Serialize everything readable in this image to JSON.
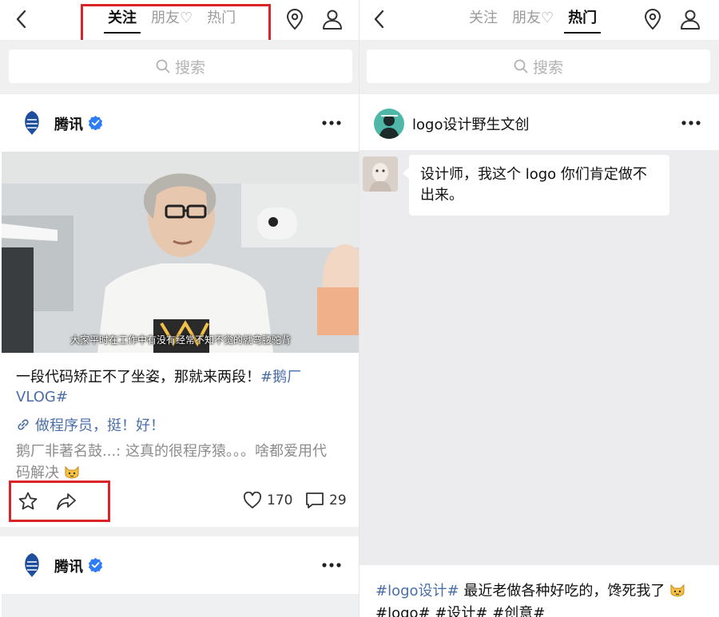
{
  "left": {
    "tabs": [
      {
        "label": "关注",
        "active": true
      },
      {
        "label": "朋友♡",
        "active": false
      },
      {
        "label": "热门",
        "active": false
      }
    ],
    "search_placeholder": "搜索",
    "post": {
      "author": "腾讯",
      "video_subtitle": "大家平时在工作中有没有经常不知不觉的就弯腰驼背",
      "caption_line1": "一段代码矫正不了坐姿，那就来两段！",
      "caption_tag1": "#鹅厂",
      "caption_tag2": "VLOG#",
      "link_text": "做程序员，挺！好！",
      "comment_line1": "鹅厂非著名鼓...: 这真的很程序猿。。。啥都爱用代",
      "comment_line2": "码解决",
      "likes": "170",
      "comments": "29"
    },
    "next_post": {
      "author": "腾讯"
    }
  },
  "right": {
    "tabs": [
      {
        "label": "关注",
        "active": false
      },
      {
        "label": "朋友♡",
        "active": false
      },
      {
        "label": "热门",
        "active": true
      }
    ],
    "search_placeholder": "搜索",
    "post": {
      "author": "logo设计野生文创",
      "bubble_text": "设计师，我这个 logo 你们肯定做不出来。",
      "hash_tag": "#logo设计#",
      "hash_text": " 最近老做各种好吃的，馋死我了",
      "tags_line": "#logo# #设计# #创意#"
    }
  },
  "colors": {
    "highlight": "#d9252a",
    "link": "#4a6ea9",
    "verified": "#2f7df6"
  }
}
